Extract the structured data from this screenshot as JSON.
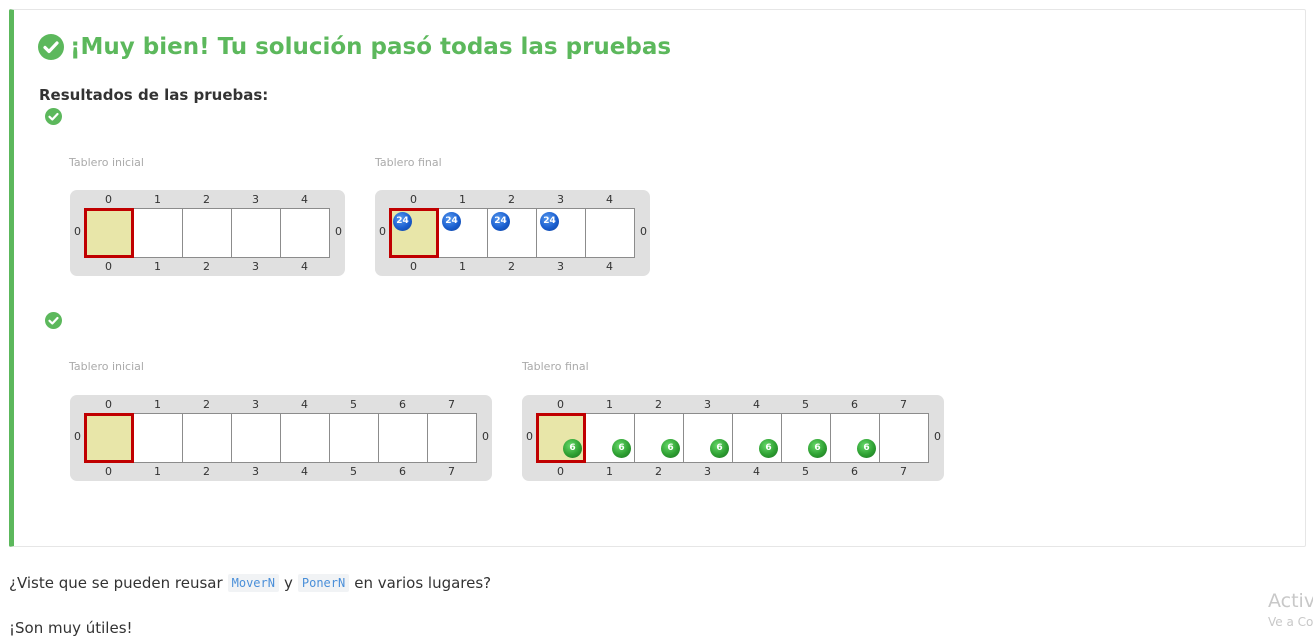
{
  "result": {
    "title": "¡Muy bien! Tu solución pasó todas las pruebas",
    "results_label": "Resultados de las pruebas:",
    "accent_color": "#5cb85c",
    "status_icon": "check-circle-icon"
  },
  "tests": [
    {
      "status": "passed",
      "initial_caption": "Tablero inicial",
      "final_caption": "Tablero final",
      "initial_board": {
        "columns": [
          "0",
          "1",
          "2",
          "3",
          "4"
        ],
        "row_label": "0",
        "head_column": 0,
        "balls": []
      },
      "final_board": {
        "columns": [
          "0",
          "1",
          "2",
          "3",
          "4"
        ],
        "row_label": "0",
        "head_column": 0,
        "balls": [
          {
            "column": 0,
            "color": "blue",
            "count": "24"
          },
          {
            "column": 1,
            "color": "blue",
            "count": "24"
          },
          {
            "column": 2,
            "color": "blue",
            "count": "24"
          },
          {
            "column": 3,
            "color": "blue",
            "count": "24"
          }
        ]
      }
    },
    {
      "status": "passed",
      "initial_caption": "Tablero inicial",
      "final_caption": "Tablero final",
      "initial_board": {
        "columns": [
          "0",
          "1",
          "2",
          "3",
          "4",
          "5",
          "6",
          "7"
        ],
        "row_label": "0",
        "head_column": 0,
        "balls": []
      },
      "final_board": {
        "columns": [
          "0",
          "1",
          "2",
          "3",
          "4",
          "5",
          "6",
          "7"
        ],
        "row_label": "0",
        "head_column": 0,
        "balls": [
          {
            "column": 0,
            "color": "green",
            "count": "6"
          },
          {
            "column": 1,
            "color": "green",
            "count": "6"
          },
          {
            "column": 2,
            "color": "green",
            "count": "6"
          },
          {
            "column": 3,
            "color": "green",
            "count": "6"
          },
          {
            "column": 4,
            "color": "green",
            "count": "6"
          },
          {
            "column": 5,
            "color": "green",
            "count": "6"
          },
          {
            "column": 6,
            "color": "green",
            "count": "6"
          }
        ]
      }
    }
  ],
  "follow_up": {
    "before": "¿Viste que se pueden reusar",
    "code1": "MoverN",
    "middle": "y",
    "code2": "PonerN",
    "after": "en varios lugares?",
    "closing": "¡Son muy útiles!"
  },
  "watermark": {
    "line1": "Activ",
    "line2": "Ve a Co"
  }
}
